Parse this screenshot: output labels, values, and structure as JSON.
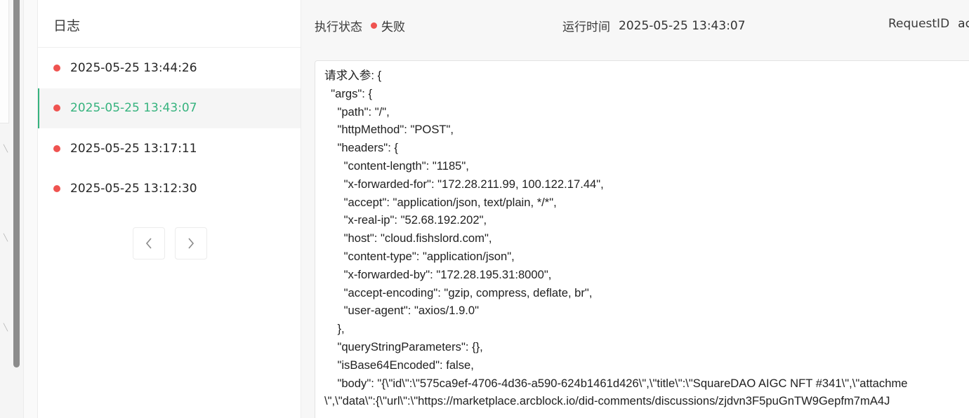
{
  "sidebar": {
    "title": "日志",
    "items": [
      {
        "time": "2025-05-25 13:44:26",
        "status": "failed"
      },
      {
        "time": "2025-05-25 13:43:07",
        "status": "failed",
        "active": true
      },
      {
        "time": "2025-05-25 13:17:11",
        "status": "failed"
      },
      {
        "time": "2025-05-25 13:12:30",
        "status": "failed"
      }
    ],
    "pager": {
      "prev_icon": "chevron-left-icon",
      "next_icon": "chevron-right-icon"
    }
  },
  "header": {
    "status_label": "执行状态",
    "status_value": "失败",
    "runtime_label": "运行时间",
    "runtime_value": "2025-05-25 13:43:07",
    "request_id_label": "RequestID",
    "request_id_value": "ac"
  },
  "log_content": "请求入参: {\n  \"args\": {\n    \"path\": \"/\",\n    \"httpMethod\": \"POST\",\n    \"headers\": {\n      \"content-length\": \"1185\",\n      \"x-forwarded-for\": \"172.28.211.99, 100.122.17.44\",\n      \"accept\": \"application/json, text/plain, */*\",\n      \"x-real-ip\": \"52.68.192.202\",\n      \"host\": \"cloud.fishslord.com\",\n      \"content-type\": \"application/json\",\n      \"x-forwarded-by\": \"172.28.195.31:8000\",\n      \"accept-encoding\": \"gzip, compress, deflate, br\",\n      \"user-agent\": \"axios/1.9.0\"\n    },\n    \"queryStringParameters\": {},\n    \"isBase64Encoded\": false,\n    \"body\": \"{\\\"id\\\":\\\"575ca9ef-4706-4d36-a590-624b1461d426\\\",\\\"title\\\":\\\"SquareDAO AIGC NFT #341\\\",\\\"attachme\n\\\",\\\"data\\\":{\\\"url\\\":\\\"https://marketplace.arcblock.io/did-comments/discussions/zjdvn3F5puGnTW9Gepfm7mA4J",
  "colors": {
    "accent": "#36b37e",
    "error": "#ef5350"
  }
}
